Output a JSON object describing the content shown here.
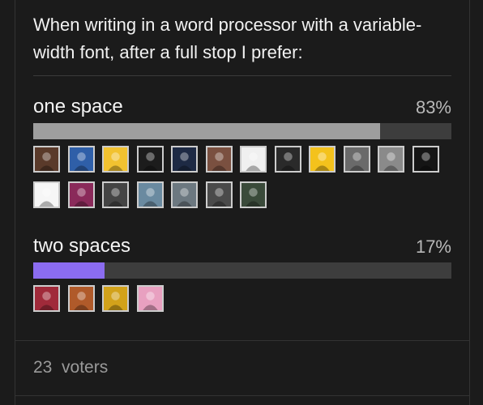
{
  "poll": {
    "question": "When writing in a word processor with a variable-width font, after a full stop I prefer:",
    "options": [
      {
        "label": "one space",
        "percent_text": "83%",
        "percent": 83,
        "bar_color": "#9e9e9e",
        "avatars": [
          "#5a3a2a",
          "#2f5fa8",
          "#f2c230",
          "#1c1c1c",
          "#1e2a44",
          "#7a5040",
          "#f0f0f0",
          "#2a2a2a",
          "#f4c21c",
          "#6a6a6a",
          "#8a8a8a",
          "#151515",
          "#f6f6f6",
          "#8a2a5a",
          "#444444",
          "#6a8aa0",
          "#6c7880",
          "#4a4a4a",
          "#3a4a3a"
        ]
      },
      {
        "label": "two spaces",
        "percent_text": "17%",
        "percent": 17,
        "bar_color": "#8b6cf0",
        "avatars": [
          "#a02a3a",
          "#b05a2a",
          "#d2a21a",
          "#e8a0c0"
        ]
      }
    ],
    "voters_count": "23",
    "voters_label": "voters"
  }
}
